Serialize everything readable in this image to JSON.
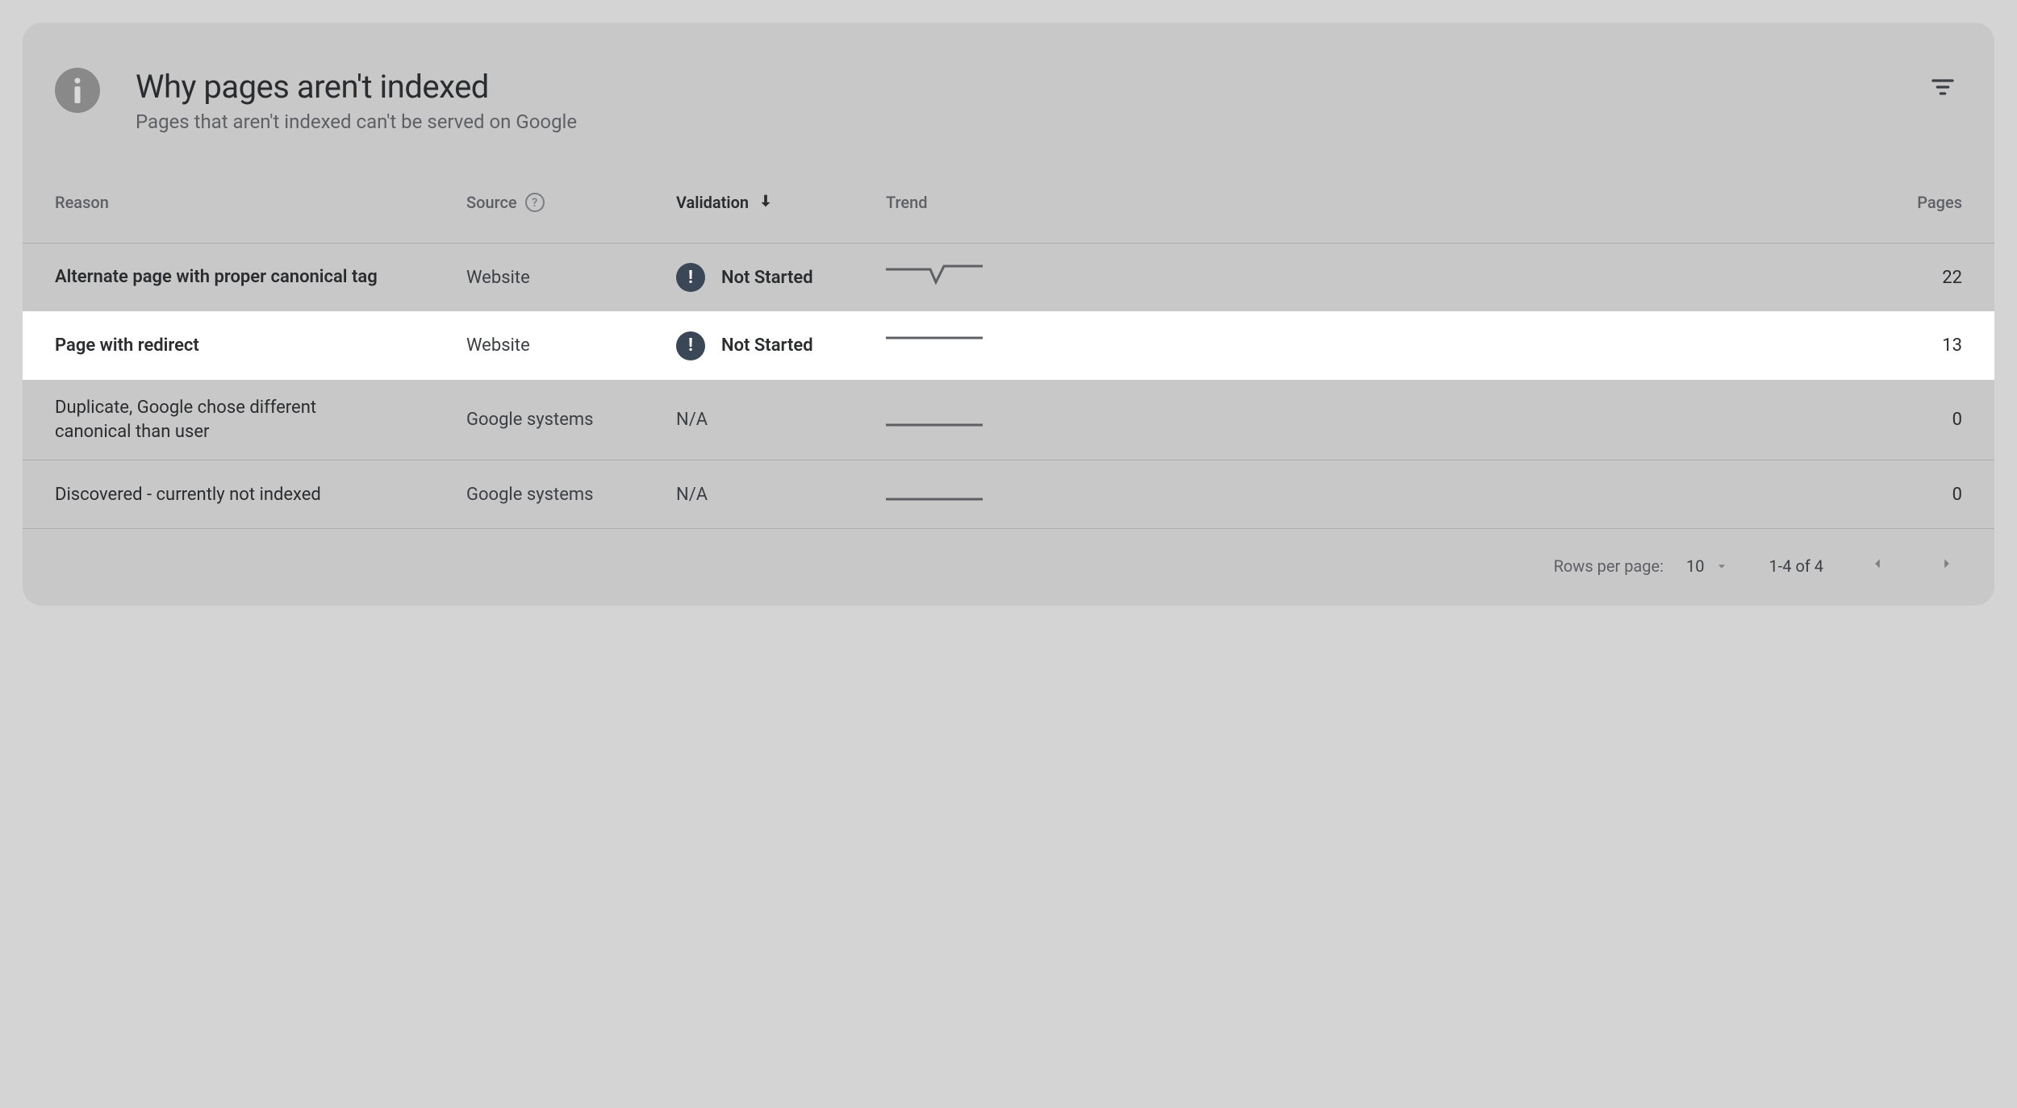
{
  "header": {
    "title": "Why pages aren't indexed",
    "subtitle": "Pages that aren't indexed can't be served on Google"
  },
  "columns": {
    "reason": "Reason",
    "source": "Source",
    "validation": "Validation",
    "trend": "Trend",
    "pages": "Pages"
  },
  "rows": [
    {
      "reason": "Alternate page with proper canonical tag",
      "source": "Website",
      "validation": "Not Started",
      "has_badge": true,
      "pages": "22",
      "bold": true,
      "highlight": false,
      "trend": "dip"
    },
    {
      "reason": "Page with redirect",
      "source": "Website",
      "validation": "Not Started",
      "has_badge": true,
      "pages": "13",
      "bold": true,
      "highlight": true,
      "trend": "flat-top"
    },
    {
      "reason": "Duplicate, Google chose different canonical than user",
      "source": "Google systems",
      "validation": "N/A",
      "has_badge": false,
      "pages": "0",
      "bold": false,
      "highlight": false,
      "trend": "flat-bottom"
    },
    {
      "reason": "Discovered - currently not indexed",
      "source": "Google systems",
      "validation": "N/A",
      "has_badge": false,
      "pages": "0",
      "bold": false,
      "highlight": false,
      "trend": "flat-bottom"
    }
  ],
  "footer": {
    "rows_per_page_label": "Rows per page:",
    "rows_per_page_value": "10",
    "range": "1-4 of 4"
  }
}
